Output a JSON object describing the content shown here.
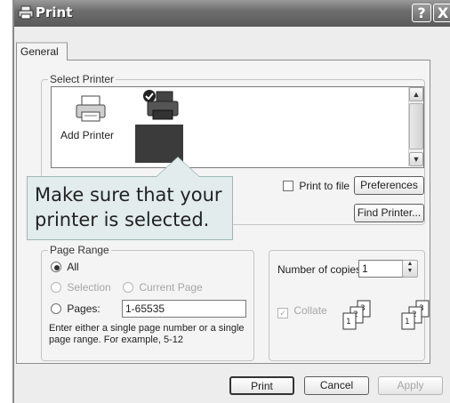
{
  "window": {
    "title": "Print",
    "help": "?",
    "close": "X"
  },
  "tabs": [
    {
      "label": "General"
    }
  ],
  "select_printer": {
    "legend": "Select Printer",
    "items": [
      {
        "label": "Add Printer",
        "icon": "add-printer-icon"
      },
      {
        "label": "",
        "icon": "printer-icon"
      }
    ],
    "print_to_file": {
      "label": "Print to file",
      "checked": false
    },
    "preferences_label": "Preferences",
    "find_printer_label": "Find Printer..."
  },
  "callout": {
    "line1": "Make sure that your",
    "line2": "printer is selected."
  },
  "page_range": {
    "legend": "Page Range",
    "all": "All",
    "selection": "Selection",
    "current_page": "Current Page",
    "pages": "Pages:",
    "pages_value": "1-65535",
    "hint_line1": "Enter either a single page number or a single",
    "hint_line2": "page range.  For example, 5-12"
  },
  "copies": {
    "label": "Number of copies:",
    "value": "1",
    "collate_label": "Collate",
    "collate_checked": true
  },
  "buttons": {
    "print": "Print",
    "cancel": "Cancel",
    "apply": "Apply"
  },
  "colors": {
    "titlebar": "#6e6e6e",
    "callout_bg": "#e2ecec",
    "selection": "#3b3b3b"
  }
}
